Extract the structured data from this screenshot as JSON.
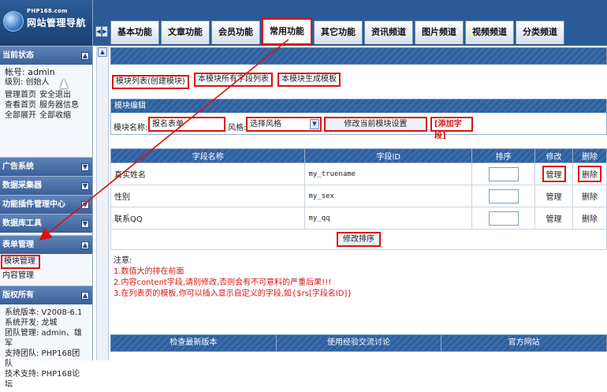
{
  "logo": {
    "site": "PHP168.com",
    "title": "网站管理导航"
  },
  "tabs": [
    "基本功能",
    "文章功能",
    "会员功能",
    "常用功能",
    "其它功能",
    "资讯频道",
    "图片频道",
    "视频频道",
    "分类频道"
  ],
  "sidebar": {
    "status": {
      "title": "当前状态",
      "account_line": "帐号: admin",
      "level_line": "级别: 创始人",
      "links": [
        [
          "管理首页",
          "安全退出"
        ],
        [
          "查看首页",
          "服务器信息"
        ],
        [
          "全部展开",
          "全部收缩"
        ]
      ]
    },
    "sections": [
      "广告系统",
      "数据采集器",
      "功能插件管理中心",
      "数据库工具"
    ],
    "form": {
      "title": "表单管理",
      "items": [
        "模块管理",
        "内容管理"
      ]
    },
    "copyright": {
      "title": "版权所有",
      "lines": [
        "系统版本: V2008-6.1",
        "系统开发: 龙城",
        "团队管理: admin、雄军",
        "支持团队: PHP168团队",
        "技术支持: PHP168论坛"
      ]
    }
  },
  "main": {
    "links": [
      "模块列表(创建模块)",
      "本模块所有字段列表",
      "本模块生成模板"
    ],
    "edit": {
      "header": "模块编辑",
      "name_label": "模块名称:",
      "name_value": "报名表单",
      "style_label": "风格:",
      "style_value": "选择风格",
      "modify_button": "修改当前模块设置",
      "add_field": "[添加字段]"
    },
    "table": {
      "headers": [
        "字段名称",
        "字段ID",
        "排序",
        "修改",
        "删除"
      ],
      "rows": [
        {
          "name": "真实姓名",
          "id": "my_truename",
          "edit": "管理",
          "del": "删除"
        },
        {
          "name": "性别",
          "id": "my_sex",
          "edit": "管理",
          "del": "删除"
        },
        {
          "name": "联系QQ",
          "id": "my_qq",
          "edit": "管理",
          "del": "删除"
        }
      ],
      "sort_button": "修改排序"
    },
    "notes": {
      "title": "注意:",
      "items": [
        "1.数值大的排在前面",
        "2.内容content字段,请别修改,否则会有不可意料的严重后果!!!",
        "3.在列表页的模板,你可以插入显示自定义的字段,如{$rs[字段名ID]}"
      ]
    },
    "footer": [
      "检查最新版本",
      "使用经验交流讨论",
      "官方网站"
    ]
  },
  "colors": {
    "highlight": "#dd1111",
    "header_blue": "#2e5f9c",
    "logo_blue": "#1b3f73"
  }
}
